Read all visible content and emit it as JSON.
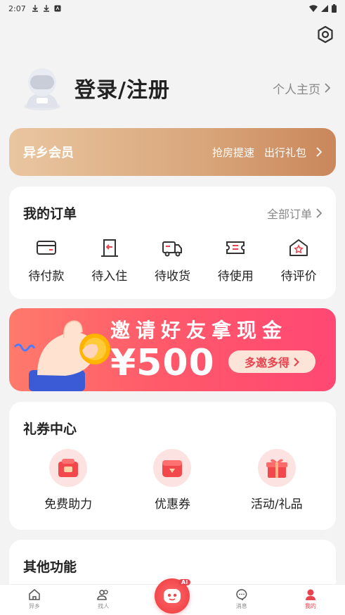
{
  "status_bar": {
    "time": "2:07"
  },
  "profile": {
    "login_title": "登录/注册",
    "homepage_label": "个人主页"
  },
  "vip": {
    "title": "异乡会员",
    "link1": "抢房提速",
    "link2": "出行礼包"
  },
  "orders": {
    "title": "我的订单",
    "more": "全部订单",
    "items": [
      {
        "label": "待付款",
        "icon": "wallet-icon"
      },
      {
        "label": "待入住",
        "icon": "door-icon"
      },
      {
        "label": "待收货",
        "icon": "truck-icon"
      },
      {
        "label": "待使用",
        "icon": "ticket-icon"
      },
      {
        "label": "待评价",
        "icon": "house-star-icon"
      }
    ]
  },
  "banner": {
    "title": "邀请好友拿现金",
    "amount": "¥500",
    "button": "多邀多得"
  },
  "coupons": {
    "title": "礼券中心",
    "items": [
      {
        "label": "免费助力",
        "icon": "gift-box-icon"
      },
      {
        "label": "优惠券",
        "icon": "coupon-icon"
      },
      {
        "label": "活动/礼品",
        "icon": "present-icon"
      }
    ]
  },
  "others": {
    "title": "其他功能"
  },
  "tabbar": {
    "items": [
      {
        "label": "异乡"
      },
      {
        "label": "找人"
      },
      {
        "label": "消息"
      },
      {
        "label": "我的"
      }
    ],
    "ai_badge": "AI"
  },
  "colors": {
    "accent": "#e8444f",
    "vip_gold": "#d9a57a",
    "banner_red": "#ff5a6a"
  }
}
